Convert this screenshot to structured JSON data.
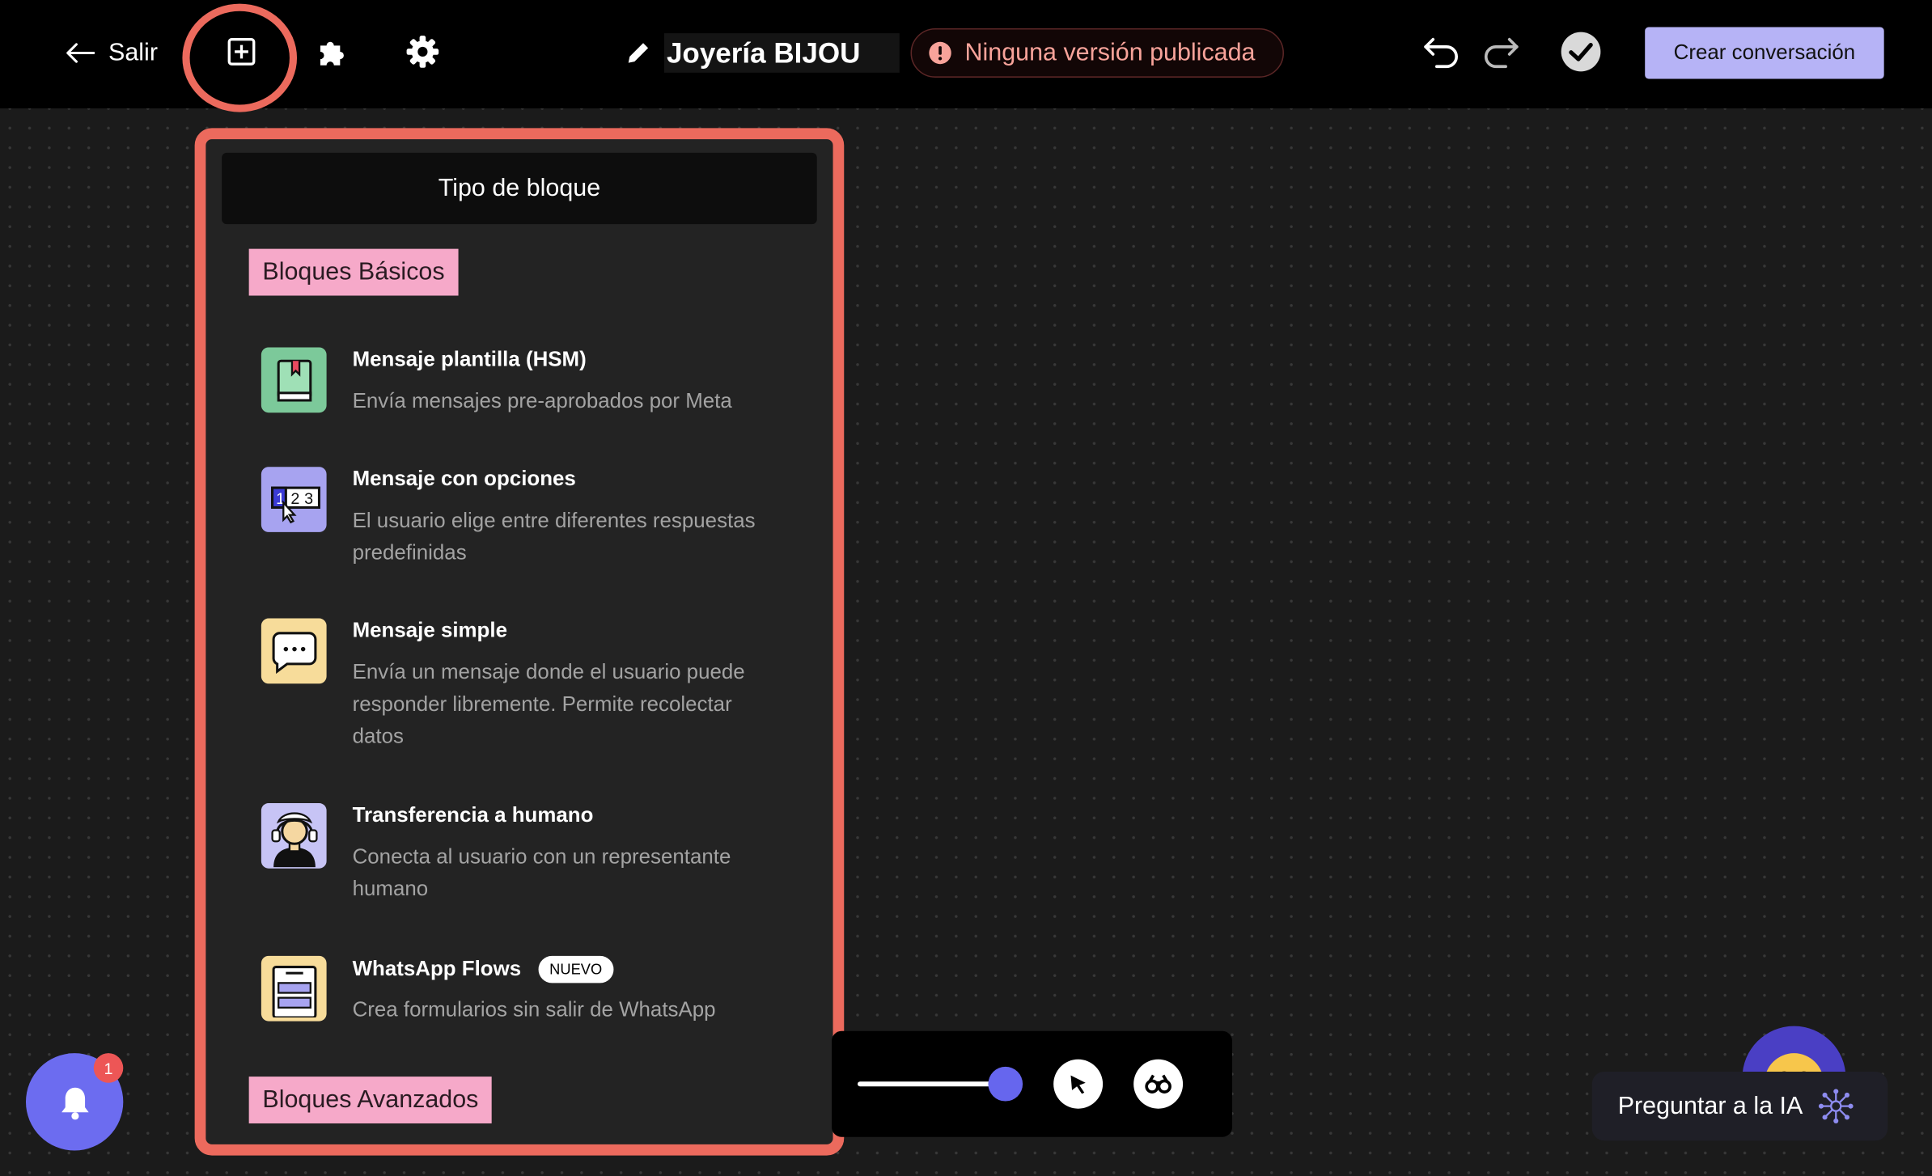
{
  "topbar": {
    "back_label": "Salir",
    "title": "Joyería BIJOU",
    "status": "Ninguna versión publicada",
    "create_label": "Crear conversación"
  },
  "panel": {
    "header": "Tipo de bloque",
    "section_basic": "Bloques Básicos",
    "section_advanced": "Bloques Avanzados",
    "items": [
      {
        "title": "Mensaje plantilla (HSM)",
        "desc": "Envía mensajes pre-aprobados por Meta",
        "icon": "template-book-icon"
      },
      {
        "title": "Mensaje con opciones",
        "desc": "El usuario elige entre diferentes respuestas predefinidas",
        "icon": "options-123-icon"
      },
      {
        "title": "Mensaje simple",
        "desc": "Envía un mensaje donde el usuario puede responder libremente. Permite recolectar datos",
        "icon": "chat-bubble-icon"
      },
      {
        "title": "Transferencia a humano",
        "desc": "Conecta al usuario con un representante humano",
        "icon": "agent-headset-icon"
      },
      {
        "title": "WhatsApp Flows",
        "badge": "NUEVO",
        "desc": "Crea formularios sin salir de WhatsApp",
        "icon": "form-icon"
      }
    ]
  },
  "notifications": {
    "count": "1"
  },
  "ai": {
    "label": "Preguntar a la IA"
  },
  "zoom": {
    "level": 1.0
  },
  "colors": {
    "accent": "#6c6cf0",
    "highlight": "#ec6a5d",
    "tag": "#f6a9c9",
    "create_button": "#b6b3f6"
  }
}
